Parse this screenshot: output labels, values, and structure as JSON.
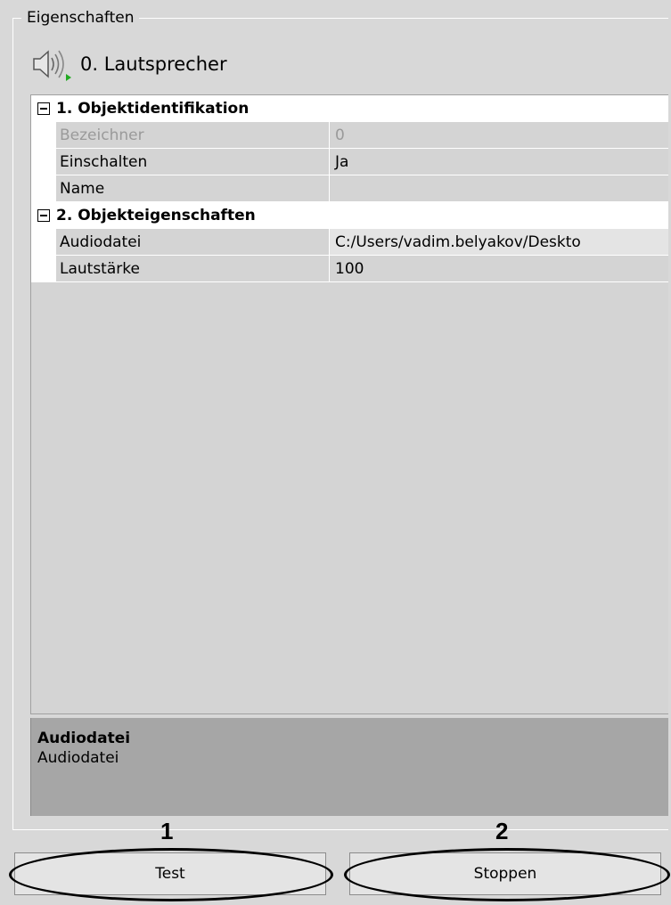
{
  "panel": {
    "group_title": "Eigenschaften"
  },
  "header": {
    "icon": "speaker-icon",
    "title": "0. Lautsprecher"
  },
  "property_grid": {
    "categories": [
      {
        "label": "1. Objektidentifikation",
        "properties": [
          {
            "name": "Bezeichner",
            "value": "0",
            "enabled": false
          },
          {
            "name": "Einschalten",
            "value": "Ja",
            "enabled": true
          },
          {
            "name": "Name",
            "value": "",
            "enabled": true
          }
        ]
      },
      {
        "label": "2. Objekteigenschaften",
        "properties": [
          {
            "name": "Audiodatei",
            "value": "C:/Users/vadim.belyakov/Deskto",
            "enabled": true,
            "selected": true
          },
          {
            "name": "Lautstärke",
            "value": "100",
            "enabled": true
          }
        ]
      }
    ]
  },
  "description": {
    "title": "Audiodatei",
    "text": "Audiodatei"
  },
  "annotations": {
    "marker_1": "1",
    "marker_2": "2"
  },
  "buttons": {
    "test_label": "Test",
    "stop_label": "Stoppen"
  },
  "colors": {
    "background": "#d8d8d8",
    "category_row": "#ffffff",
    "description_bg": "#a6a6a6",
    "icon_green": "#22aa22"
  }
}
